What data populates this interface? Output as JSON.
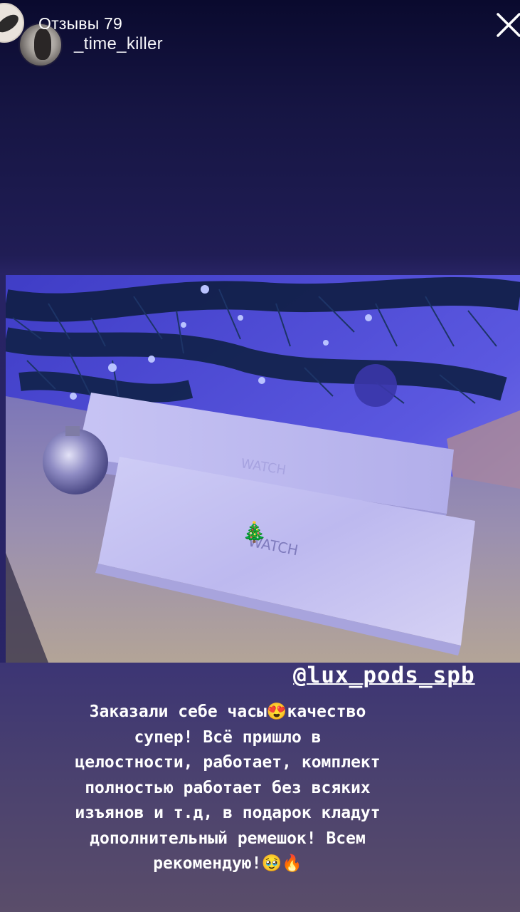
{
  "header": {
    "story_title": "Отзывы 79",
    "username": "_time_killer",
    "close_icon": "close-icon"
  },
  "photo": {
    "description_icon": "photo",
    "box_brand_front": "WATCH",
    "box_brand_back": "WATCH",
    "sticker": "🎄"
  },
  "caption": {
    "mention": "@lux_pods_spb",
    "text": "Заказали себе часы😍качество\nсупер! Всё пришло в\nцелостности, работает, комплект\nполностью работает без всяких\nизъянов и т.д, в подарок кладут\nдополнительный ремешок! Всем\nрекомендую!🥹🔥"
  },
  "colors": {
    "background_top": "#0a0a2e",
    "background_mid": "#2b2669",
    "caption_bg": "#4a416f"
  }
}
